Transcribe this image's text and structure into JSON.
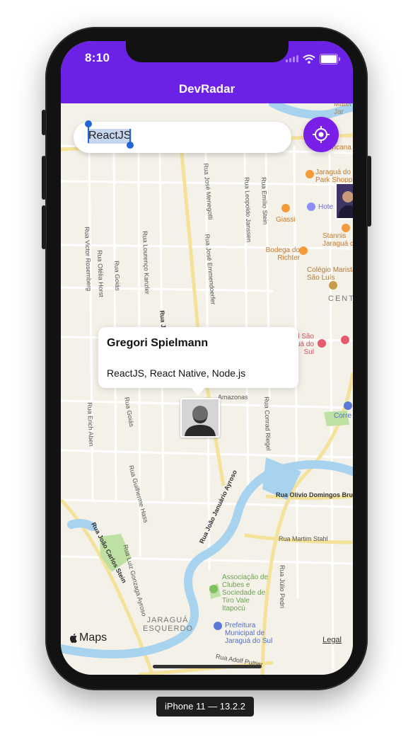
{
  "status_bar": {
    "time": "8:10"
  },
  "header": {
    "title": "DevRadar"
  },
  "search": {
    "value": "ReactJS"
  },
  "callout": {
    "name": "Gregori Spielmann",
    "techs": "ReactJS, React Native, Node.js"
  },
  "map": {
    "attribution": "Maps",
    "legal": "Legal",
    "labels": {
      "rua_joao_pianir": "Rua João Pianir",
      "rua_jose_menegotti": "Rua José Menegotti",
      "rua_jose_emmendoerfer": "Rua José Emmendoerfer",
      "rua_leopoldo_janssen": "Rua Leopoldo Janssen",
      "rua_emilio_stein": "Rua Emílio Stein",
      "rua_lourenco_kanzler": "Rua Lourenço Kanzler",
      "rua_goias_top": "Rua Goiás",
      "rua_goias_bottom": "Rua Goiás",
      "rua_ofelia_horst": "Rua Ofélia Horst",
      "rua_victor_rosemberg": "Rua Victor Rosemberg",
      "rua_erich_abel": "Rua Erich Aben",
      "rua_guilherme_hass": "Rua Guilherme Hass",
      "rua_joao_carlos_stein": "Rua João Carlos Stein",
      "rua_luiz_gonzaga_ayroso": "Rua Luiz Gonzaga Ayroso",
      "rua_joao_januario_ayroso": "Rua João Januário Ayroso",
      "rua_conrad_riegel": "Rua Conrad Riegel",
      "rua_olivio": "Rua Olívio Domingos Bru",
      "rua_martim_stahl": "Rua Martim Stahl",
      "rua_julio_pedri": "Rua Júlio Pedri",
      "rua_amazonas": "Amazonas",
      "rua_adolfo": "Rua Adolf Puttjer",
      "giassi": "Giassi",
      "bodega": "Bodega do Richter",
      "colegio": "Colégio Marista São Luís",
      "jaragua_park": "Jaraguá do Park Shopp",
      "hotel": "Hote",
      "stannis": "Stannis Jaraguá c",
      "centro": "CENT",
      "correios": "Corre",
      "hospital_sao": "Hospital São Jaraguá do Sul",
      "associacao": "Associação de Clubes e Sociedade de Tiro Vale Itapocú",
      "prefeitura": "Prefeitura Municipal de Jaraguá do Sul",
      "jaragua_esquerdo": "JARAGUÁ ESQUERDO",
      "matera": "Mater Jar",
      "americana": "ericana"
    }
  },
  "device_label": "iPhone 11 — 13.2.2",
  "colors": {
    "accent": "#6c21e6",
    "location_button": "#7a1fe8",
    "map_bg": "#f4f1e8"
  }
}
